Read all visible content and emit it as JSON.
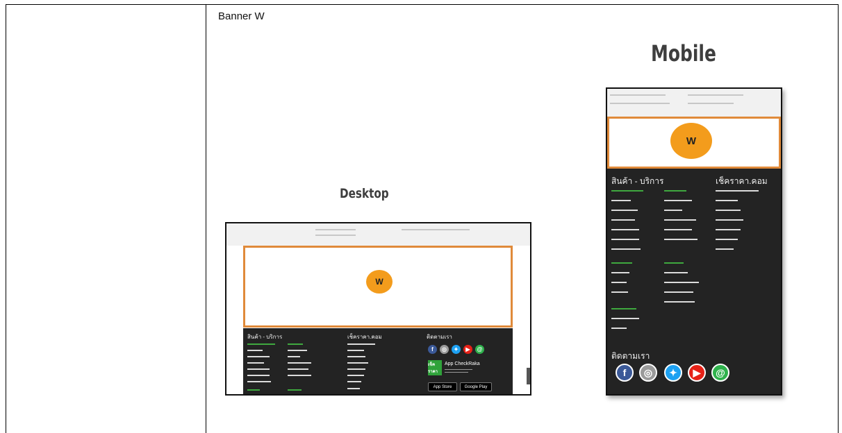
{
  "caption": "Banner W",
  "mobile": {
    "heading": "Mobile",
    "banner_logo": "W",
    "footer": {
      "col1_title": "สินค้า - บริการ",
      "col2_title": "เช็คราคา.คอม",
      "follow_title": "ติดตามเรา"
    },
    "social_icons": [
      "facebook-icon",
      "instagram-icon",
      "twitter-icon",
      "youtube-icon",
      "line-icon"
    ]
  },
  "desktop": {
    "heading": "Desktop",
    "banner_logo": "W",
    "footer": {
      "col1_title": "สินค้า - บริการ",
      "col2_title": "เช็คราคา.คอม",
      "follow_title": "ติดตามเรา",
      "checkraka_badge": "เช็ค ราคา",
      "app_name": "App CheckRaka",
      "app_store": "App Store",
      "google_play": "Google Play"
    },
    "social_icons": [
      "facebook-icon",
      "instagram-icon",
      "twitter-icon",
      "youtube-icon",
      "line-icon"
    ]
  },
  "colors": {
    "banner_border": "#e08a3a",
    "logo_fill": "#f39c1c",
    "footer_bg": "#232323",
    "green": "#3fa93f",
    "facebook": "#3b5998",
    "instagram": "#9a9a9a",
    "twitter": "#1da1f2",
    "youtube": "#e62117",
    "line": "#2fb24c"
  }
}
